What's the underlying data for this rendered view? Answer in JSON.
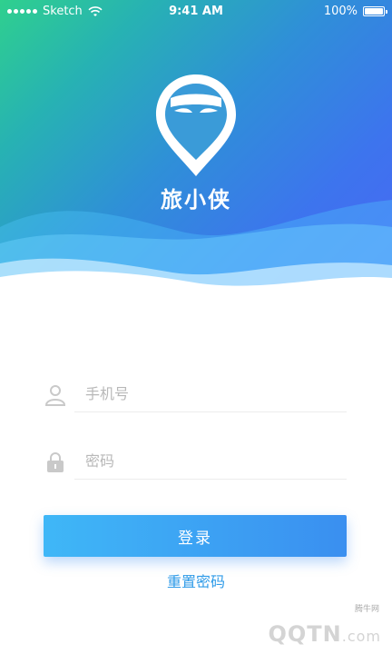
{
  "status_bar": {
    "carrier": "Sketch",
    "time": "9:41 AM",
    "battery_percent": "100%"
  },
  "app": {
    "name": "旅小侠",
    "logo_icon": "masked-hero-pin-icon"
  },
  "form": {
    "phone_placeholder": "手机号",
    "phone_icon": "user-icon",
    "password_placeholder": "密码",
    "password_icon": "lock-icon",
    "login_label": "登录",
    "reset_label": "重置密码"
  },
  "watermark": {
    "brand": "QQTN",
    "domain_suffix": ".com",
    "chinese": "腾牛网"
  },
  "colors": {
    "accent": "#3a8ff0",
    "link": "#2f9be8",
    "gradient_start": "#2fd08e",
    "gradient_end": "#4a67f3"
  }
}
